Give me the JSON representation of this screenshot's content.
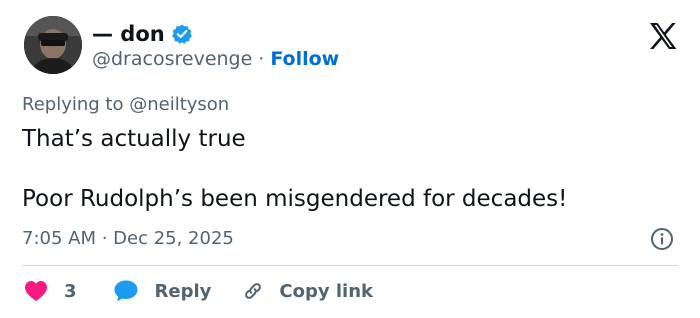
{
  "header": {
    "display_name": "— don",
    "handle": "@dracosrevenge",
    "separator": "·",
    "follow_label": "Follow"
  },
  "reply": {
    "prefix": "Replying to",
    "mention": "@neiltyson"
  },
  "tweet": {
    "line1": "That’s actually true",
    "line2": "Poor Rudolph’s been misgendered for decades!"
  },
  "meta": {
    "timestamp": "7:05 AM · Dec 25, 2025"
  },
  "actions": {
    "like_count": "3",
    "reply_label": "Reply",
    "copy_link_label": "Copy link"
  },
  "icons": {
    "verified": "verified-badge-icon",
    "x_logo": "x-logo-icon",
    "info": "info-icon",
    "heart": "heart-icon",
    "reply": "speech-bubble-icon",
    "copy_link": "link-icon"
  },
  "colors": {
    "accent_blue": "#1d9bf0",
    "follow_blue": "#006fd6",
    "heart_pink": "#f91880",
    "secondary_text": "#536471",
    "primary_text": "#0f1419",
    "divider": "#cfd9de"
  }
}
